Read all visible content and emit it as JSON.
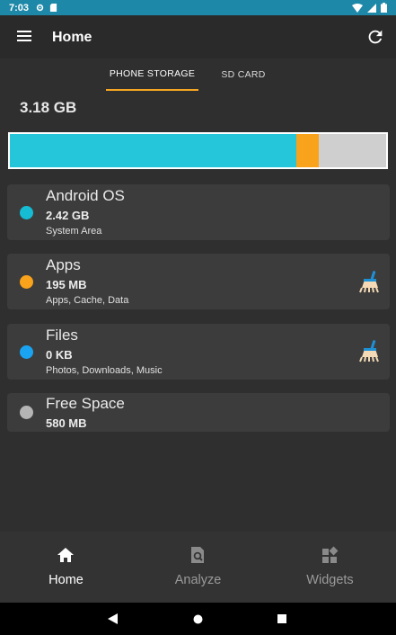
{
  "status_bar": {
    "time": "7:03",
    "icons": [
      "settings-icon",
      "sd-card-icon"
    ],
    "right_icons": [
      "wifi-icon",
      "signal-icon",
      "battery-icon"
    ]
  },
  "app_bar": {
    "title": "Home",
    "menu_icon": "menu-icon",
    "refresh_icon": "refresh-icon"
  },
  "tabs": [
    {
      "label": "PHONE STORAGE",
      "active": true
    },
    {
      "label": "SD CARD",
      "active": false
    }
  ],
  "total_size": "3.18 GB",
  "usage_bar": {
    "segments": [
      {
        "name": "Android OS",
        "fraction": 0.761,
        "color": "#25c6da"
      },
      {
        "name": "Apps",
        "fraction": 0.061,
        "color": "#f9a21b"
      },
      {
        "name": "Files",
        "fraction": 0.0,
        "color": "#1aa3f0"
      },
      {
        "name": "Free Space",
        "fraction": 0.178,
        "color": "#cfcfcf"
      }
    ]
  },
  "categories": [
    {
      "name": "Android OS",
      "size": "2.42 GB",
      "description": "System Area",
      "color": "#15bcd4",
      "cleanable": false
    },
    {
      "name": "Apps",
      "size": "195 MB",
      "description": "Apps, Cache, Data",
      "color": "#f9a21b",
      "cleanable": true
    },
    {
      "name": "Files",
      "size": "0 KB",
      "description": "Photos, Downloads, Music",
      "color": "#1aa3f0",
      "cleanable": true
    },
    {
      "name": "Free Space",
      "size": "580 MB",
      "description": "",
      "color": "#b5b5b5",
      "cleanable": false
    }
  ],
  "bottom_nav": [
    {
      "label": "Home",
      "icon": "home-icon",
      "active": true
    },
    {
      "label": "Analyze",
      "icon": "analyze-icon",
      "active": false
    },
    {
      "label": "Widgets",
      "icon": "widgets-icon",
      "active": false
    }
  ],
  "system_nav": [
    "back-icon",
    "home-circle-icon",
    "recents-icon"
  ],
  "colors": {
    "status_bar": "#1e88a8",
    "accent": "#f5a623",
    "background": "#2f2f2f",
    "card": "#3c3c3c"
  }
}
